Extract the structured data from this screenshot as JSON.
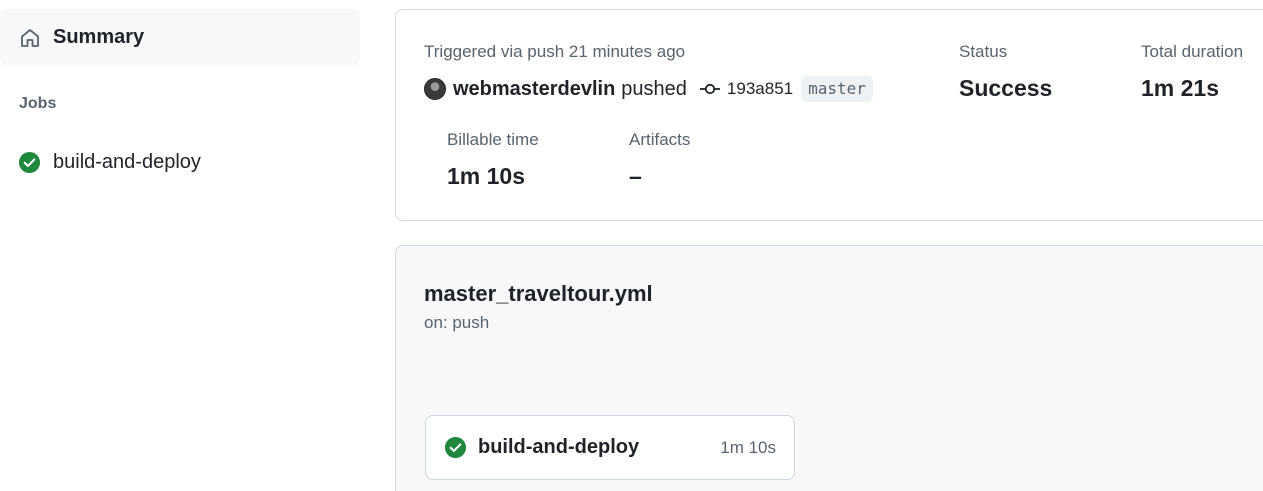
{
  "sidebar": {
    "summary_label": "Summary",
    "jobs_heading": "Jobs",
    "jobs": [
      {
        "label": "build-and-deploy",
        "status": "success"
      }
    ]
  },
  "summary": {
    "trigger_text": "Triggered via push 21 minutes ago",
    "user": "webmasterdevlin",
    "action": "pushed",
    "commit_sha": "193a851",
    "branch": "master",
    "status_label": "Status",
    "status_value": "Success",
    "total_duration_label": "Total duration",
    "total_duration_value": "1m 21s",
    "billable_label": "Billable time",
    "billable_value": "1m 10s",
    "artifacts_label": "Artifacts",
    "artifacts_value": "–"
  },
  "workflow": {
    "file": "master_traveltour.yml",
    "trigger": "on: push",
    "job": {
      "name": "build-and-deploy",
      "duration": "1m 10s",
      "status": "success"
    }
  },
  "colors": {
    "success": "#1f883d",
    "muted": "#59636e",
    "border": "#d0d7de",
    "panel": "#f6f8fa"
  },
  "icons": {
    "summary": "home-icon",
    "job_status": "check-circle-icon",
    "commit": "git-commit-icon"
  }
}
